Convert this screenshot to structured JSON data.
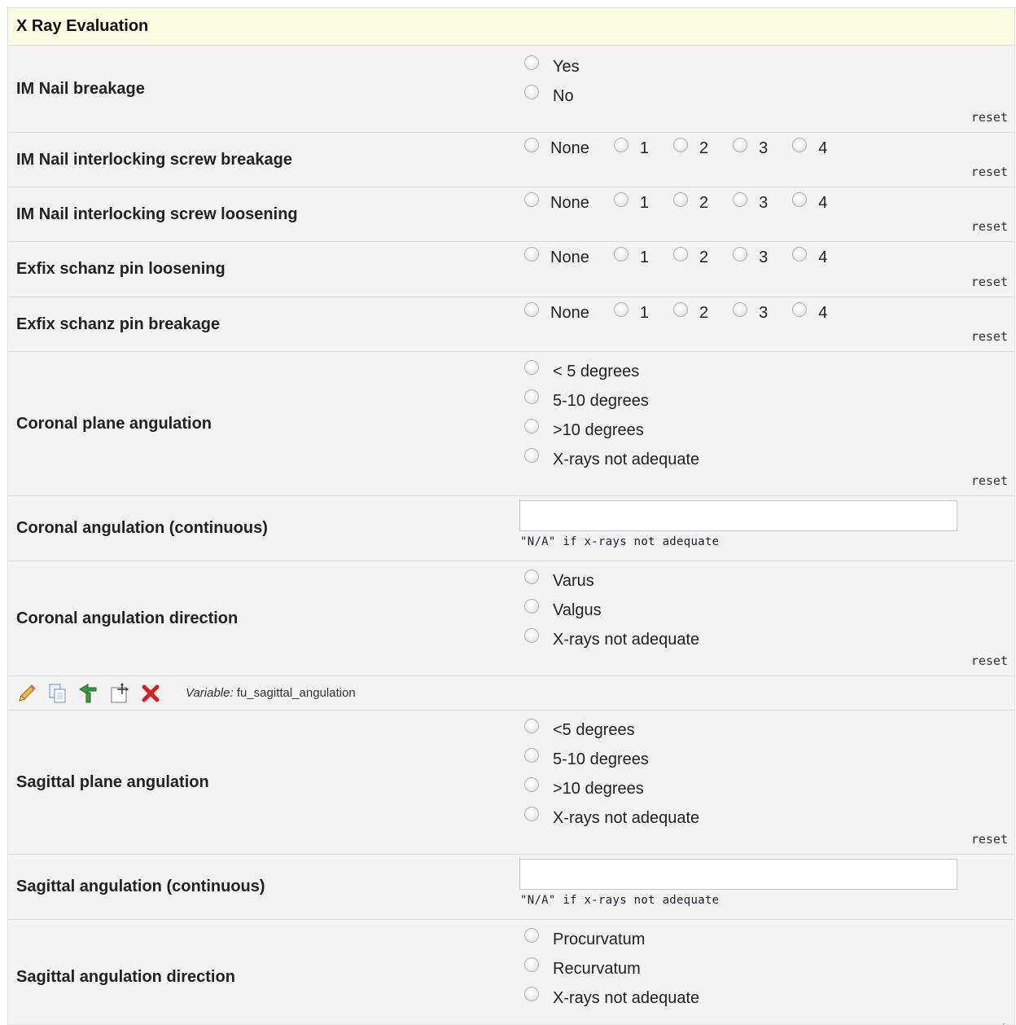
{
  "section_title": "X Ray Evaluation",
  "reset_label": "reset",
  "hint_text": "\"N/A\" if x-rays not adequate",
  "rows": [
    {
      "label": "IM Nail breakage",
      "options": [
        "Yes",
        "No"
      ]
    },
    {
      "label": "IM Nail interlocking screw breakage",
      "options": [
        "None",
        "1",
        "2",
        "3",
        "4"
      ]
    },
    {
      "label": "IM Nail interlocking screw loosening",
      "options": [
        "None",
        "1",
        "2",
        "3",
        "4"
      ]
    },
    {
      "label": "Exfix schanz pin loosening",
      "options": [
        "None",
        "1",
        "2",
        "3",
        "4"
      ]
    },
    {
      "label": "Exfix schanz pin breakage",
      "options": [
        "None",
        "1",
        "2",
        "3",
        "4"
      ]
    },
    {
      "label": "Coronal plane angulation",
      "options": [
        "< 5 degrees",
        "5-10 degrees",
        ">10 degrees",
        "X-rays not adequate"
      ]
    },
    {
      "label": "Coronal angulation (continuous)",
      "value": ""
    },
    {
      "label": "Coronal angulation direction",
      "options": [
        "Varus",
        "Valgus",
        "X-rays not adequate"
      ]
    },
    {
      "label": "Sagittal plane angulation",
      "options": [
        "<5 degrees",
        "5-10 degrees",
        ">10 degrees",
        "X-rays not adequate"
      ]
    },
    {
      "label": "Sagittal angulation (continuous)",
      "value": ""
    },
    {
      "label": "Sagittal angulation direction",
      "options": [
        "Procurvatum",
        "Recurvatum",
        "X-rays not adequate"
      ]
    }
  ],
  "toolbar": {
    "variable_prefix": "Variable:",
    "variable_name": "fu_sagittal_angulation",
    "icons": [
      "pencil-icon",
      "copy-icon",
      "branch-icon",
      "move-icon",
      "delete-icon"
    ]
  }
}
